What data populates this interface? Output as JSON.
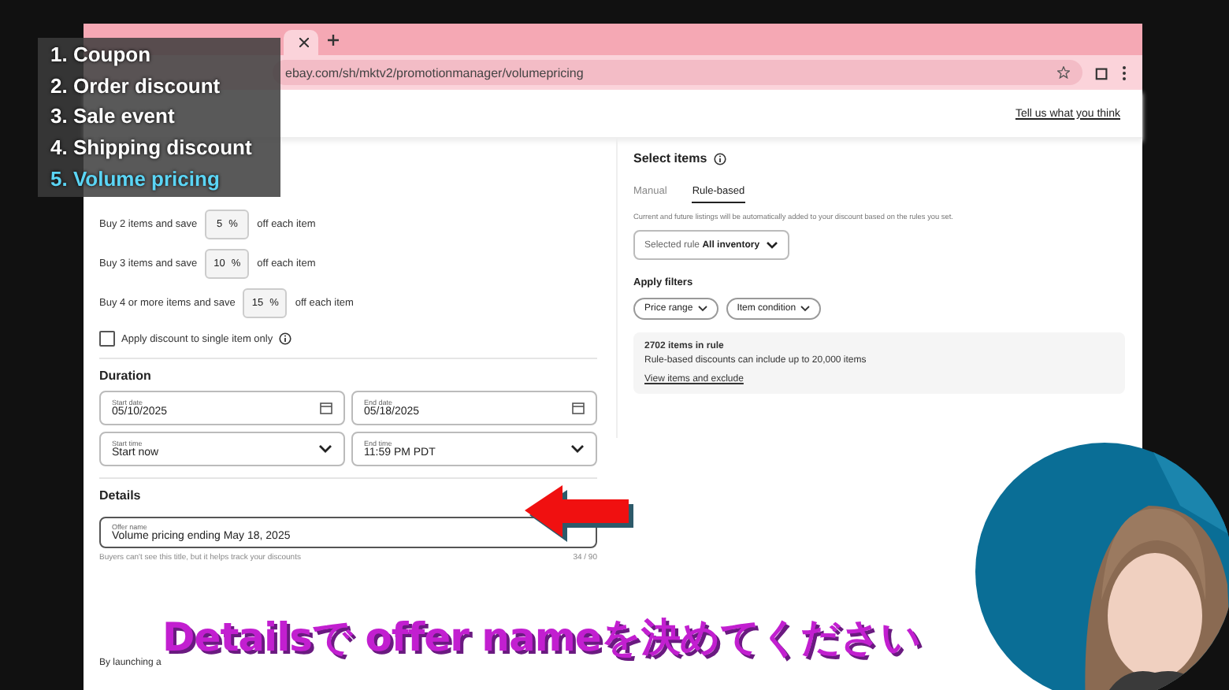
{
  "overlay_list": [
    {
      "label": "1. Coupon",
      "selected": false
    },
    {
      "label": "2. Order discount",
      "selected": false
    },
    {
      "label": "3. Sale event",
      "selected": false
    },
    {
      "label": "4. Shipping discount",
      "selected": false
    },
    {
      "label": "5. Volume pricing",
      "selected": true
    }
  ],
  "browser": {
    "url": "ebay.com/sh/mktv2/promotionmanager/volumepricing"
  },
  "header": {
    "feedback_link": "Tell us what you think"
  },
  "tiers": [
    {
      "prefix": "Buy 2 items and save",
      "value": "5",
      "unit": "%",
      "suffix": "off each item"
    },
    {
      "prefix": "Buy 3 items and save",
      "value": "10",
      "unit": "%",
      "suffix": "off each item"
    },
    {
      "prefix": "Buy 4 or more items and save",
      "value": "15",
      "unit": "%",
      "suffix": "off each item"
    }
  ],
  "single_item": {
    "label": "Apply discount to single item only",
    "checked": false
  },
  "duration": {
    "title": "Duration",
    "fields": [
      {
        "label": "Start date",
        "value": "05/10/2025",
        "kind": "date"
      },
      {
        "label": "End date",
        "value": "05/18/2025",
        "kind": "date"
      },
      {
        "label": "Start time",
        "value": "Start now",
        "kind": "select"
      },
      {
        "label": "End time",
        "value": "11:59 PM PDT",
        "kind": "select"
      }
    ]
  },
  "details": {
    "title": "Details",
    "field": {
      "label": "Offer name",
      "value": "Volume pricing ending May 18, 2025"
    },
    "hint": "Buyers can't see this title, but it helps track your discounts",
    "counter": "34 / 90"
  },
  "legal_text": "By launching a",
  "select_items": {
    "title": "Select items",
    "tabs": [
      {
        "label": "Manual",
        "selected": false
      },
      {
        "label": "Rule-based",
        "selected": true
      }
    ],
    "description": "Current and future listings will be automatically added to your discount based on the rules you set.",
    "rule": {
      "prefix": "Selected rule",
      "value": "All inventory"
    },
    "filters_title": "Apply filters",
    "filters": [
      "Price range",
      "Item condition"
    ],
    "summary": {
      "count": "2702 items in rule",
      "note": "Rule-based discounts can include up to 20,000 items",
      "link": "View items and exclude"
    }
  },
  "subtitle": "Detailsで offer nameを決めてください"
}
